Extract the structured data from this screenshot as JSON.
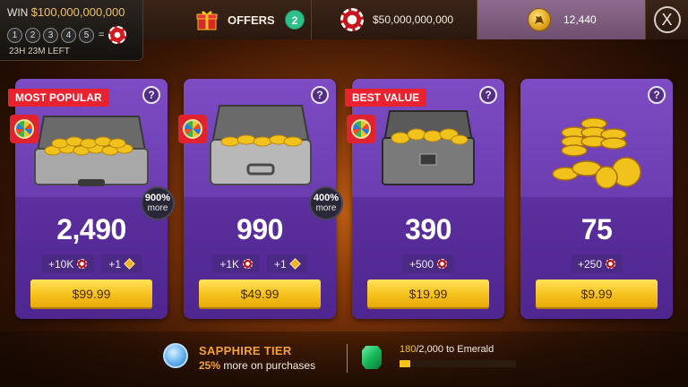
{
  "jackpot": {
    "win_prefix": "WIN",
    "win_amount": "$100,000,000,000",
    "balls": [
      "1",
      "2",
      "3",
      "4",
      "5"
    ],
    "equals": "=",
    "time_left": "23H 23M LEFT"
  },
  "topbar": {
    "offers_label": "OFFERS",
    "offers_count": "2",
    "chips_balance": "$50,000,000,000",
    "gold_balance": "12,440",
    "close_symbol": "X"
  },
  "cards": [
    {
      "ribbon": "MOST POPULAR",
      "help": "?",
      "more_pct": "900%",
      "more_word": "more",
      "gold": "2,490",
      "bonus_chips": "+10K",
      "bonus_gems": "+1",
      "price": "$99.99"
    },
    {
      "ribbon": "",
      "help": "?",
      "more_pct": "400%",
      "more_word": "more",
      "gold": "990",
      "bonus_chips": "+1K",
      "bonus_gems": "+1",
      "price": "$49.99"
    },
    {
      "ribbon": "BEST VALUE",
      "help": "?",
      "gold": "390",
      "bonus_chips": "+500",
      "price": "$19.99"
    },
    {
      "help": "?",
      "gold": "75",
      "bonus_chips": "+250",
      "price": "$9.99"
    }
  ],
  "tier": {
    "name": "SAPPHIRE TIER",
    "bonus_pct": "25%",
    "bonus_text": "more on purchases",
    "progress_current": "180",
    "progress_rest": "/2,000 to Emerald",
    "progress_fraction": 0.09
  },
  "colors": {
    "card_purple": "#5a2e9c",
    "price_yellow": "#f6c21c",
    "ribbon_red": "#e8232f",
    "tier_orange": "#f2a23a",
    "badge_green": "#2fc08a"
  }
}
